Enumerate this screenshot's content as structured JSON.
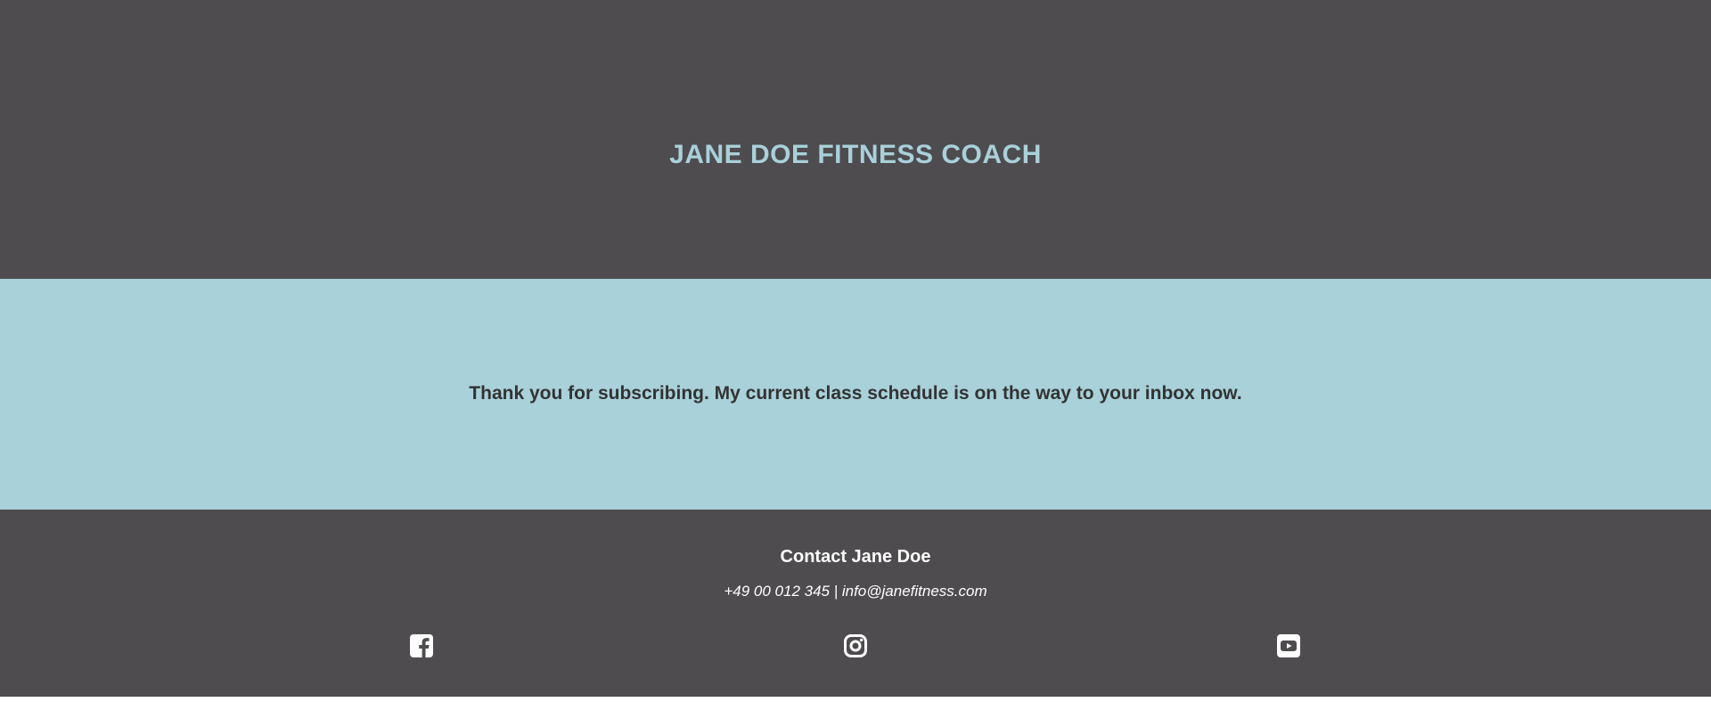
{
  "header": {
    "title": "JANE DOE FITNESS COACH"
  },
  "hero": {
    "message": "Thank you for subscribing. My current class schedule is on the way to your inbox now."
  },
  "footer": {
    "contact_heading": "Contact Jane Doe",
    "contact_line": "+49 00 012 345 | info@janefitness.com",
    "social": [
      {
        "icon": "facebook-icon"
      },
      {
        "icon": "instagram-icon"
      },
      {
        "icon": "youtube-icon"
      }
    ]
  },
  "colors": {
    "dark_background": "#4e4c4e",
    "accent": "#a8d1da",
    "body_text": "#333333",
    "footer_text": "#ffffff"
  }
}
